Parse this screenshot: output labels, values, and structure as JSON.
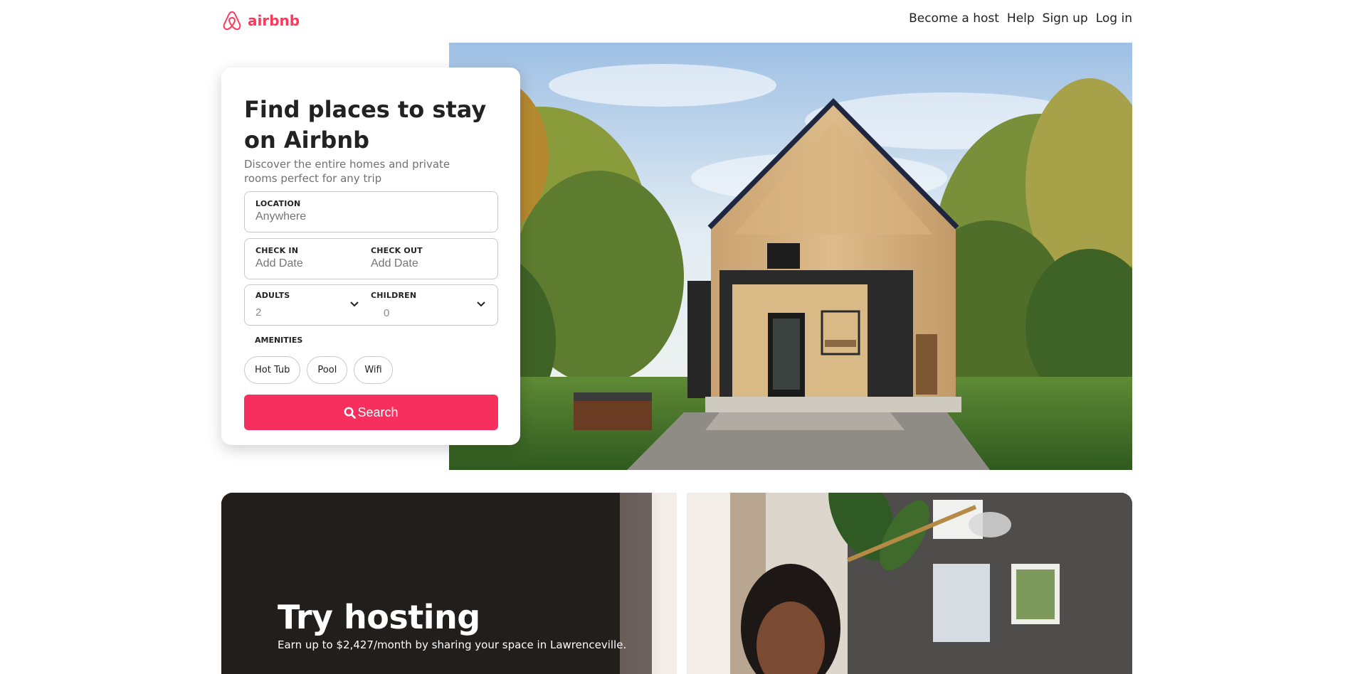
{
  "header": {
    "brand": "airbnb",
    "nav": [
      "Become a host",
      "Help",
      "Sign up",
      "Log in"
    ]
  },
  "search_card": {
    "title": "Find places to stay on Airbnb",
    "subtitle": "Discover the entire homes and private rooms perfect for any trip",
    "location": {
      "label": "LOCATION",
      "placeholder": "Anywhere"
    },
    "check_in": {
      "label": "CHECK IN",
      "placeholder": "Add Date"
    },
    "check_out": {
      "label": "CHECK OUT",
      "placeholder": "Add Date"
    },
    "adults": {
      "label": "ADULTS",
      "value": "2"
    },
    "children": {
      "label": "CHILDREN",
      "value": "0"
    },
    "amenities_label": "AMENITIES",
    "amenities": [
      "Hot Tub",
      "Pool",
      "Wifi"
    ],
    "search_label": "Search"
  },
  "banner": {
    "title": "Try hosting",
    "text": "Earn up to $2,427/month by sharing your space in Lawrenceville."
  },
  "colors": {
    "brand": "#ff385c",
    "search_button": "#f72f5e",
    "banner_bg": "#221e1b"
  }
}
